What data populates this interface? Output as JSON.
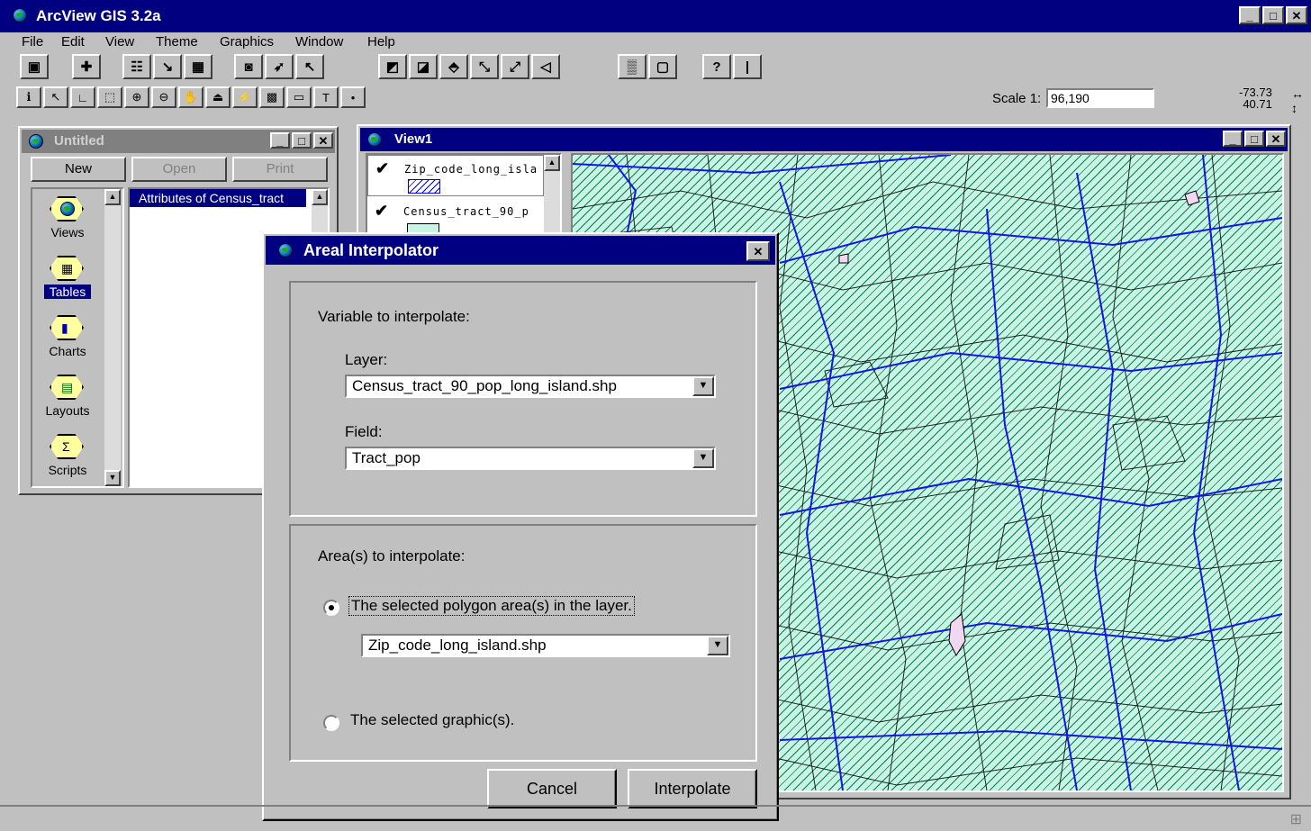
{
  "app": {
    "title": "ArcView GIS 3.2a"
  },
  "window_controls": {
    "minimize": "_",
    "maximize": "□",
    "close": "✕"
  },
  "menu": [
    "File",
    "Edit",
    "View",
    "Theme",
    "Graphics",
    "Window",
    "Help"
  ],
  "toolbar": {
    "scale_label": "Scale 1:",
    "scale_value": "96,190",
    "coord_x": "-73.73",
    "coord_y": "40.71"
  },
  "project": {
    "title": "Untitled",
    "buttons": {
      "new": "New",
      "open": "Open",
      "print": "Print"
    },
    "doc_types": [
      "Views",
      "Tables",
      "Charts",
      "Layouts",
      "Scripts"
    ],
    "selected_type": "Tables",
    "documents": [
      "Attributes of Census_tract"
    ]
  },
  "view": {
    "title": "View1",
    "themes": [
      {
        "name": "Zip_code_long_isla",
        "checked": true
      },
      {
        "name": "Census_tract_90_p",
        "checked": true
      }
    ]
  },
  "dialog": {
    "title": "Areal Interpolator",
    "variable_heading": "Variable to interpolate:",
    "layer_label": "Layer:",
    "layer_value": "Census_tract_90_pop_long_island.shp",
    "field_label": "Field:",
    "field_value": "Tract_pop",
    "area_heading": "Area(s) to interpolate:",
    "radio_polygon": "The selected polygon area(s) in the layer.",
    "polygon_layer_value": "Zip_code_long_island.shp",
    "radio_graphic": "The selected graphic(s).",
    "selected_option": "polygon",
    "cancel": "Cancel",
    "interpolate": "Interpolate"
  },
  "colors": {
    "title_active": "#000080",
    "title_inactive": "#808080",
    "map_fill": "#c8f4e4",
    "map_hatch": "#0a7a5a",
    "map_lines": "#1414e6"
  }
}
